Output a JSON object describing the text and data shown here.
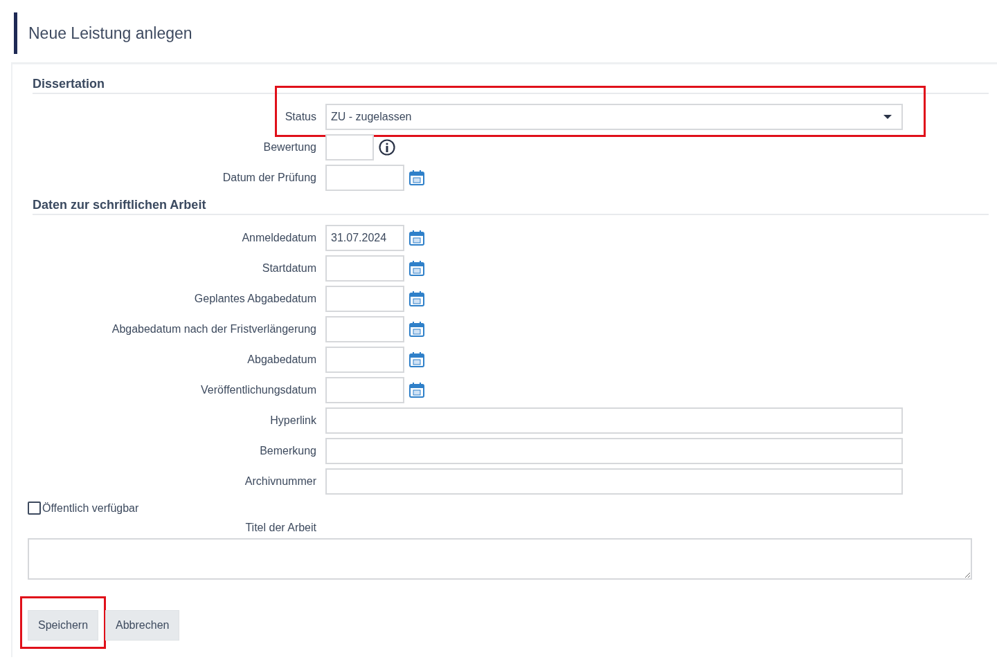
{
  "page_title": "Neue Leistung anlegen",
  "sections": [
    {
      "heading": "Dissertation",
      "fields": [
        {
          "label": "Status",
          "kind": "select",
          "value": "ZU - zugelassen",
          "highlighted": true
        },
        {
          "label": "Bewertung",
          "kind": "short"
        },
        {
          "label": "Datum der Prüfung",
          "kind": "date"
        }
      ]
    },
    {
      "heading": "Daten zur schriftlichen Arbeit",
      "fields": [
        {
          "label": "Anmeldedatum",
          "kind": "date",
          "value": "31.07.2024"
        },
        {
          "label": "Startdatum",
          "kind": "date"
        },
        {
          "label": "Geplantes Abgabedatum",
          "kind": "date"
        },
        {
          "label": "Abgabedatum nach der Fristverlängerung",
          "kind": "date"
        },
        {
          "label": "Abgabedatum",
          "kind": "date"
        },
        {
          "label": "Veröffentlichungsdatum",
          "kind": "date"
        },
        {
          "label": "Hyperlink",
          "kind": "text"
        },
        {
          "label": "Bemerkung",
          "kind": "text"
        },
        {
          "label": "Archivnummer",
          "kind": "text"
        }
      ]
    }
  ],
  "public_checkbox": {
    "label": "Öffentlich verfügbar",
    "checked": false
  },
  "title_field": {
    "label": "Titel der Arbeit"
  },
  "buttons": [
    {
      "label": "Speichern",
      "highlighted": true
    },
    {
      "label": "Abbrechen",
      "highlighted": false
    }
  ]
}
